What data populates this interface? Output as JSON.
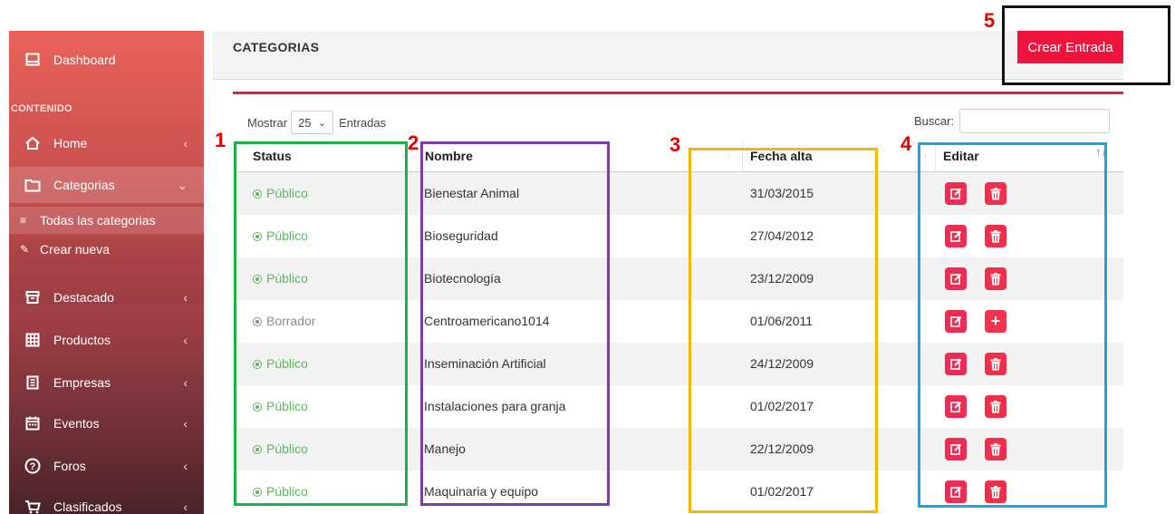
{
  "sidebar": {
    "dashboard": "Dashboard",
    "section_label": "CONTENIDO",
    "items": [
      {
        "label": "Home",
        "icon": "home-icon"
      },
      {
        "label": "Categorias",
        "icon": "folder-icon"
      },
      {
        "label": "Destacado",
        "icon": "archive-icon"
      },
      {
        "label": "Productos",
        "icon": "grid-icon"
      },
      {
        "label": "Empresas",
        "icon": "building-icon"
      },
      {
        "label": "Eventos",
        "icon": "calendar-icon"
      },
      {
        "label": "Foros",
        "icon": "help-circle-icon"
      },
      {
        "label": "Clasificados",
        "icon": "cart-icon"
      }
    ],
    "submenu": [
      {
        "label": "Todas las categorias",
        "icon": "list-icon"
      },
      {
        "label": "Crear nueva",
        "icon": "edit-icon"
      }
    ]
  },
  "header": {
    "title": "CATEGORIAS",
    "create_button": "Crear Entrada"
  },
  "toolbar": {
    "show_label": "Mostrar",
    "page_size": "25",
    "entries_label": "Entradas",
    "search_label": "Buscar:",
    "search_value": ""
  },
  "table": {
    "columns": [
      "Status",
      "Nombre",
      "Fecha alta",
      "Editar"
    ],
    "rows": [
      {
        "status": "Público",
        "nombre": "Bienestar Animal",
        "fecha": "31/03/2015",
        "action2": "delete"
      },
      {
        "status": "Público",
        "nombre": "Bioseguridad",
        "fecha": "27/04/2012",
        "action2": "delete"
      },
      {
        "status": "Público",
        "nombre": "Biotecnología",
        "fecha": "23/12/2009",
        "action2": "delete"
      },
      {
        "status": "Borrador",
        "nombre": "Centroamericano1014",
        "fecha": "01/06/2011",
        "action2": "add"
      },
      {
        "status": "Público",
        "nombre": "Inseminación Artificial",
        "fecha": "24/12/2009",
        "action2": "delete"
      },
      {
        "status": "Público",
        "nombre": "Instalaciones para granja",
        "fecha": "01/02/2017",
        "action2": "delete"
      },
      {
        "status": "Público",
        "nombre": "Manejo",
        "fecha": "22/12/2009",
        "action2": "delete"
      },
      {
        "status": "Público",
        "nombre": "Maquinaria y equipo",
        "fecha": "01/02/2017",
        "action2": "delete"
      }
    ]
  },
  "annotations": {
    "labels": [
      "1",
      "2",
      "3",
      "4",
      "5"
    ],
    "colors": {
      "1": "#1db04b",
      "2": "#7b3fa3",
      "3": "#f5b800",
      "4": "#1aa7e0",
      "5": "#111111"
    },
    "number_color": "#e00000"
  },
  "colors": {
    "accent": "#f0143c",
    "status_public": "#5cb85c",
    "status_draft": "#8a8a8a"
  }
}
